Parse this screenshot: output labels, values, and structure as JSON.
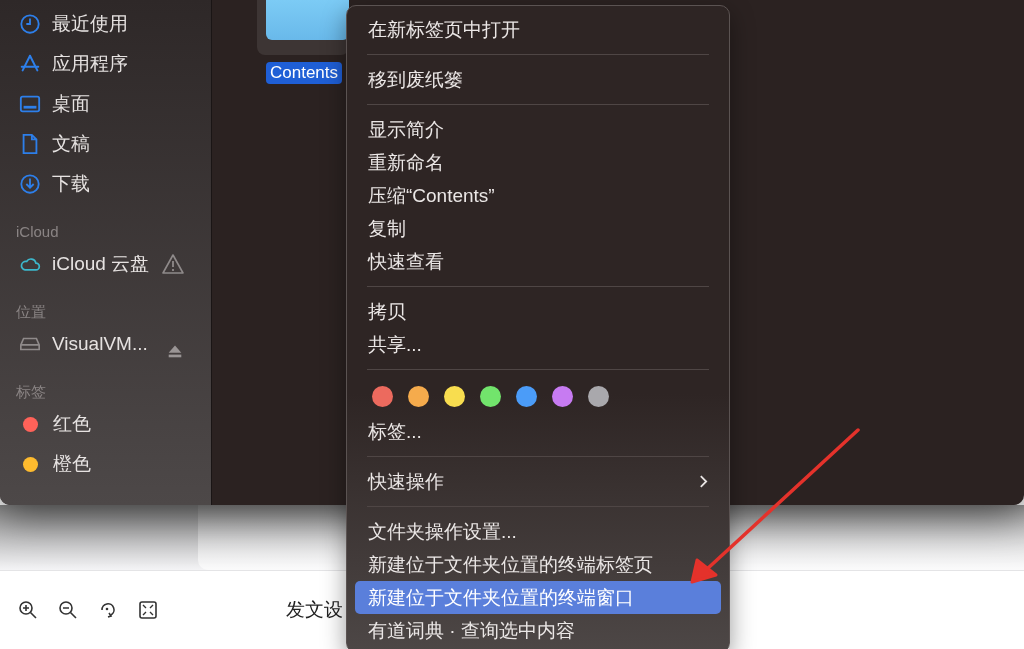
{
  "sidebar": {
    "sections": [
      {
        "items": [
          {
            "label": "最近使用"
          },
          {
            "label": "应用程序"
          },
          {
            "label": "桌面"
          },
          {
            "label": "文稿"
          },
          {
            "label": "下载"
          }
        ]
      },
      {
        "title": "iCloud",
        "items": [
          {
            "label": "iCloud 云盘"
          }
        ]
      },
      {
        "title": "位置",
        "items": [
          {
            "label": "VisualVM..."
          }
        ]
      },
      {
        "title": "标签",
        "items": [
          {
            "label": "红色",
            "color": "#ff6259"
          },
          {
            "label": "橙色",
            "color": "#febb2e"
          }
        ]
      }
    ]
  },
  "file": {
    "name": "Contents",
    "selected": true
  },
  "context_menu": {
    "groups": [
      [
        {
          "kind": "text",
          "label": "在新标签页中打开",
          "selected": false
        }
      ],
      [
        {
          "kind": "text",
          "label": "移到废纸篓",
          "selected": false
        }
      ],
      [
        {
          "kind": "text",
          "label": "显示简介",
          "selected": false
        },
        {
          "kind": "text",
          "label": "重新命名",
          "selected": false
        },
        {
          "kind": "text",
          "label": "压缩“Contents”",
          "selected": false
        },
        {
          "kind": "text",
          "label": "复制",
          "selected": false
        },
        {
          "kind": "text",
          "label": "快速查看",
          "selected": false
        }
      ],
      [
        {
          "kind": "text",
          "label": "拷贝",
          "selected": false
        },
        {
          "kind": "text",
          "label": "共享...",
          "selected": false
        }
      ],
      [
        {
          "kind": "colors",
          "colors": [
            {
              "color": "#ec6a5e"
            },
            {
              "color": "#f5ab4c"
            },
            {
              "color": "#f8dd4f"
            },
            {
              "color": "#72e46c"
            },
            {
              "color": "#4b9cf8"
            },
            {
              "color": "#c77bf2"
            },
            {
              "color": "#a9a8ac"
            }
          ]
        },
        {
          "kind": "text",
          "label": "标签...",
          "selected": false
        }
      ],
      [
        {
          "kind": "submenu",
          "label": "快速操作",
          "selected": false
        }
      ],
      [
        {
          "kind": "text",
          "label": "文件夹操作设置...",
          "selected": false
        },
        {
          "kind": "text",
          "label": "新建位于文件夹位置的终端标签页",
          "selected": false
        },
        {
          "kind": "text",
          "label": "新建位于文件夹位置的终端窗口",
          "selected": true
        },
        {
          "kind": "text",
          "label": "有道词典 · 查询选中内容",
          "selected": false
        }
      ]
    ]
  },
  "page": {
    "heading": "发文设"
  }
}
